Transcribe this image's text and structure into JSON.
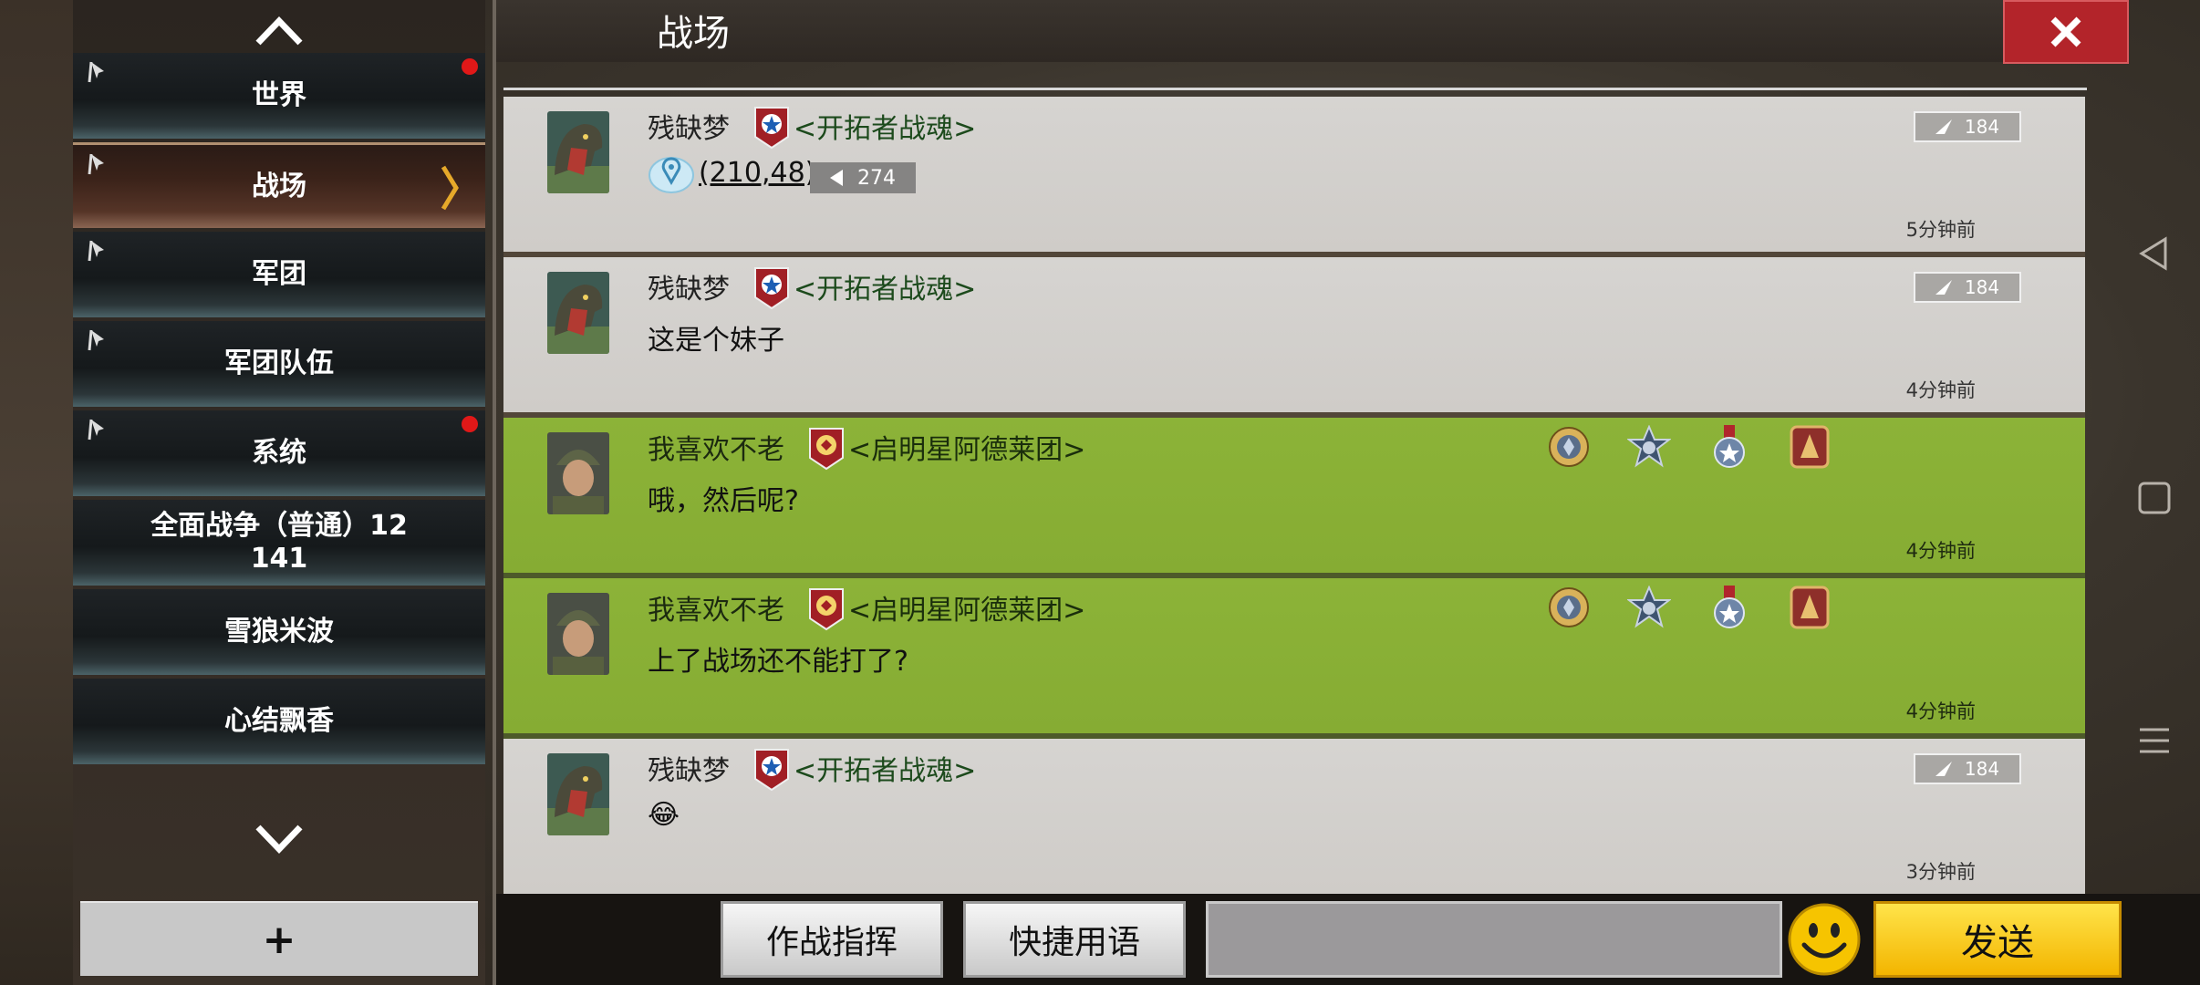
{
  "window": {
    "title": "战场",
    "close_icon": "close-icon"
  },
  "sidebar": {
    "channels": [
      {
        "label": "世界",
        "unread": true,
        "pinned": true
      },
      {
        "label": "战场",
        "unread": false,
        "pinned": true,
        "active": true
      },
      {
        "label": "军团",
        "unread": false,
        "pinned": true
      },
      {
        "label": "军团队伍",
        "unread": false,
        "pinned": true
      },
      {
        "label": "系统",
        "unread": true,
        "pinned": true
      },
      {
        "label": "全面战争（普通）12\n141",
        "label_line1": "全面战争（普通）12",
        "label_line2": "141",
        "unread": false
      },
      {
        "label": "雪狼米波",
        "unread": false
      },
      {
        "label": "心结飘香",
        "unread": false
      }
    ],
    "add_label": "+"
  },
  "messages": [
    {
      "name": "残缺梦",
      "guild": "<开拓者战魂>",
      "rank": "184",
      "coords": "(210,48)",
      "distance": "274",
      "time": "5分钟前",
      "style": "grey"
    },
    {
      "name": "残缺梦",
      "guild": "<开拓者战魂>",
      "rank": "184",
      "text": "这是个妹子",
      "time": "4分钟前",
      "style": "grey"
    },
    {
      "name": "我喜欢不老",
      "guild": "<启明星阿德莱团>",
      "text": "哦，然后呢?",
      "time": "4分钟前",
      "style": "green"
    },
    {
      "name": "我喜欢不老",
      "guild": "<启明星阿德莱团>",
      "text": "上了战场还不能打了?",
      "time": "4分钟前",
      "style": "green"
    },
    {
      "name": "残缺梦",
      "guild": "<开拓者战魂>",
      "rank": "184",
      "text": "😂",
      "time": "3分钟前",
      "style": "grey"
    }
  ],
  "toolbar": {
    "command_label": "作战指挥",
    "quick_label": "快捷用语",
    "input_value": "",
    "send_label": "发送"
  },
  "colors": {
    "unread_dot": "#e01818",
    "send_button": "#f7c400",
    "green_message": "#8cb338",
    "grey_message": "#d4d2cf",
    "close_button": "#b3242a"
  }
}
